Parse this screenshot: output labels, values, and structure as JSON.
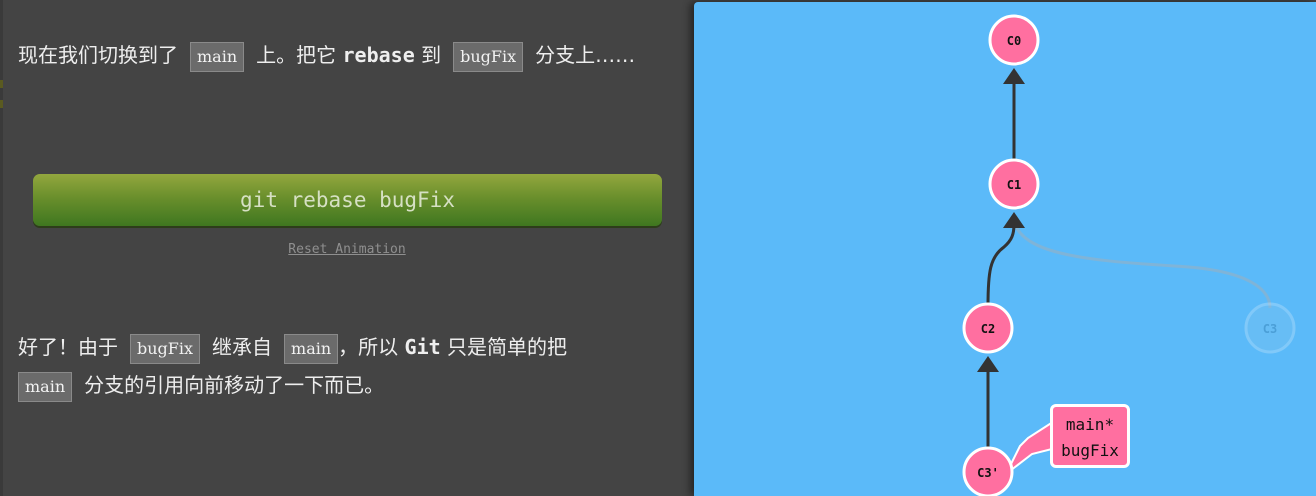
{
  "intro": {
    "part1": "现在我们切换到了",
    "code1": "main",
    "part2": "上。把它",
    "keyword": "rebase",
    "part3": "到",
    "code2": "bugFix",
    "part4": "分支上……"
  },
  "command_button": {
    "label": "git rebase bugFix"
  },
  "reset": {
    "label": "Reset Animation"
  },
  "result": {
    "part1": "好了！由于",
    "code1": "bugFix",
    "part2": "继承自",
    "code2": "main",
    "part3": "，所以",
    "keyword": "Git",
    "part4": "只是简单的把",
    "code3": "main",
    "part5": "分支的引用向前移动了一下而已。"
  },
  "graph": {
    "commits": [
      {
        "id": "C0",
        "label": "C0",
        "faded": false
      },
      {
        "id": "C1",
        "label": "C1",
        "faded": false
      },
      {
        "id": "C2",
        "label": "C2",
        "faded": false
      },
      {
        "id": "C3",
        "label": "C3",
        "faded": true
      },
      {
        "id": "C3p",
        "label": "C3'",
        "faded": false
      }
    ],
    "branch_tag": {
      "line1": "main*",
      "line2": "bugFix"
    },
    "colors": {
      "background": "#5bbaf9",
      "commit_fill": "#ff6fa0",
      "commit_stroke": "#ffffff",
      "edge": "#333333",
      "faded_edge": "#7fb4d8"
    }
  }
}
